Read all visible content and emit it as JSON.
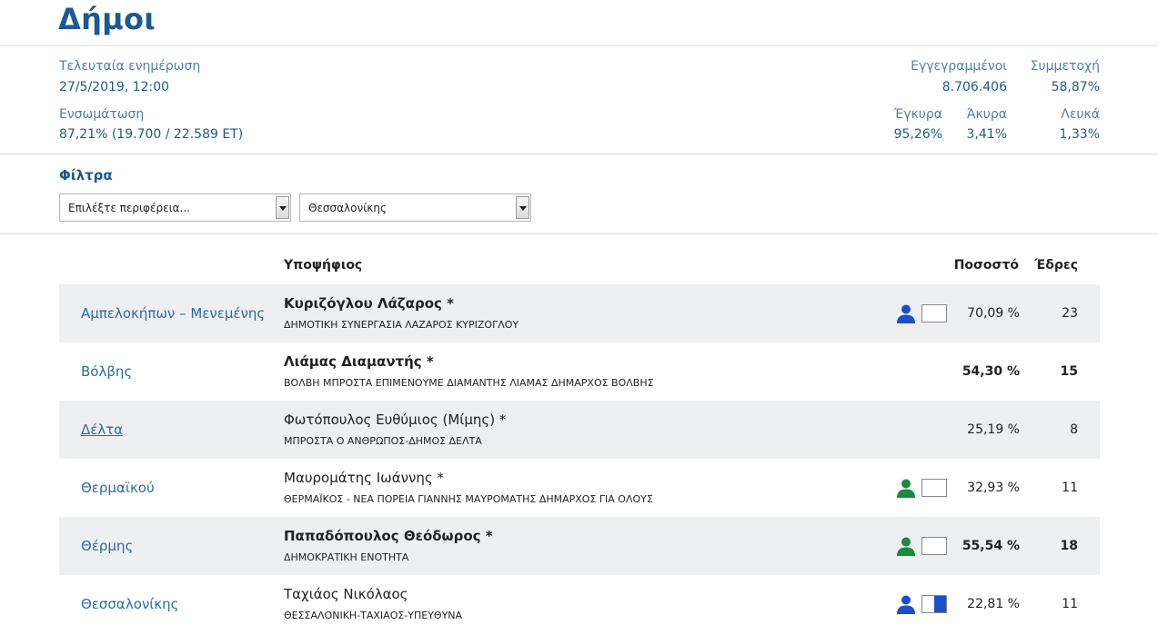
{
  "header": {
    "title": "Δήμοι"
  },
  "meta": {
    "last_update_label": "Τελευταία ενημέρωση",
    "last_update_value": "27/5/2019, 12:00",
    "integration_label": "Ενσωμάτωση",
    "integration_value": "87,21% (19.700 / 22.589 ΕΤ)",
    "registered_label": "Εγγεγραμμένοι",
    "registered_value": "8.706.406",
    "turnout_label": "Συμμετοχή",
    "turnout_value": "58,87%",
    "valid_label": "Έγκυρα",
    "valid_value": "95,26%",
    "invalid_label": "Άκυρα",
    "invalid_value": "3,41%",
    "blank_label": "Λευκά",
    "blank_value": "1,33%"
  },
  "filters": {
    "title": "Φίλτρα",
    "region_select": "Επιλέξτε περιφέρεια...",
    "municipality_select": "Θεσσαλονίκης"
  },
  "table": {
    "headers": {
      "candidate": "Υποψήφιος",
      "percent": "Ποσοστό",
      "seats": "Έδρες"
    },
    "rows": [
      {
        "municipality": "Αμπελοκήπων – Μενεμένης",
        "candidate": "Κυριζόγλου Λάζαρος *",
        "party": "ΔΗΜΟΤΙΚΗ ΣΥΝΕΡΓΑΣΙΑ ΛΑΖΑΡΟΣ ΚΥΡΙΖΟΓΛΟΥ",
        "percent": "70,09 %",
        "seats": "23",
        "icon": "person-icon",
        "icon_color": "#1e4fc9",
        "box_fill": 0
      },
      {
        "municipality": "Βόλβης",
        "candidate": "Λιάμας Διαμαντής *",
        "party": "ΒΟΛΒΗ ΜΠΡΟΣΤΑ ΕΠΙΜΕΝΟΥΜΕ ΔΙΑΜΑΝΤΗΣ ΛΙΑΜΑΣ ΔΗΜΑΡΧΟΣ ΒΟΛΒΗΣ",
        "percent": "54,30 %",
        "seats": "15"
      },
      {
        "municipality": "Δέλτα",
        "candidate": "Φωτόπουλος Ευθύμιος (Μίμης) *",
        "party": "ΜΠΡΟΣΤΑ Ο ΑΝΘΡΩΠΟΣ-ΔΗΜΟΣ ΔΕΛΤΑ",
        "percent": "25,19 %",
        "seats": "8"
      },
      {
        "municipality": "Θερμαϊκού",
        "candidate": "Μαυρομάτης Ιωάννης *",
        "party": "ΘΕΡΜΑΪΚΟΣ - ΝΕΑ ΠΟΡΕΙΑ ΓΙΑΝΝΗΣ ΜΑΥΡΟΜΑΤΗΣ ΔΗΜΑΡΧΟΣ ΓΙΑ ΟΛΟΥΣ",
        "percent": "32,93 %",
        "seats": "11",
        "icon": "person-icon",
        "icon_color": "#1a8a3c",
        "box_fill": 0
      },
      {
        "municipality": "Θέρμης",
        "candidate": "Παπαδόπουλος Θεόδωρος *",
        "party": "ΔΗΜΟΚΡΑΤΙΚΗ ΕΝΟΤΗΤΑ",
        "percent": "55,54 %",
        "seats": "18",
        "icon": "person-icon",
        "icon_color": "#1a8a3c",
        "box_fill": 0
      },
      {
        "municipality": "Θεσσαλονίκης",
        "candidate": "Ταχιάος Νικόλαος",
        "party": "ΘΕΣΣΑΛΟΝΙΚΗ-ΤΑΧΙΑΟΣ-ΥΠΕΥΘΥΝΑ",
        "percent": "22,81 %",
        "seats": "11",
        "icon": "person-icon",
        "icon_color": "#1e4fc9",
        "box_fill": 0.5
      }
    ]
  }
}
